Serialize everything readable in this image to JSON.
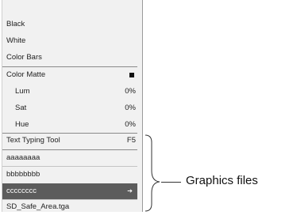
{
  "menu": {
    "items": [
      {
        "label": "Black"
      },
      {
        "label": "White"
      },
      {
        "label": "Color Bars"
      },
      {
        "label": "Color Matte"
      },
      {
        "label": "Lum",
        "value": "0%"
      },
      {
        "label": "Sat",
        "value": "0%"
      },
      {
        "label": "Hue",
        "value": "0%"
      },
      {
        "label": "Text Typing Tool",
        "shortcut": "F5"
      },
      {
        "label": "aaaaaaaa"
      },
      {
        "label": "bbbbbbbb"
      },
      {
        "label": "cccccccc",
        "selected": true,
        "submenu_arrow": "➔"
      },
      {
        "label": "SD_Safe_Area.tga"
      }
    ],
    "color_matte_swatch_color": "#111111"
  },
  "callout": {
    "label": "Graphics files"
  },
  "colors": {
    "menu_background": "#f1f1f1",
    "selected_background": "#5c5c5c",
    "selected_text": "#ffffff",
    "separator": "#8a8a8a"
  }
}
